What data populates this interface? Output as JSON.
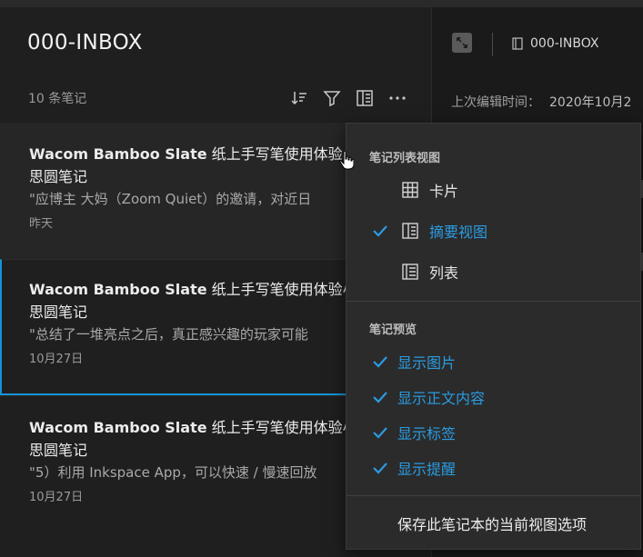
{
  "list": {
    "title": "000-INBOX",
    "count": "10 条笔记",
    "toolbar": [
      "sort-icon",
      "filter-icon",
      "view-options-icon",
      "more-icon"
    ]
  },
  "notes": [
    {
      "title_en": "Wacom Bamboo Slate",
      "title_cn": " 纸上手写笔使用体验小",
      "title_line2": "思圆笔记",
      "snippet": "\"应博主 大妈（Zoom Quiet）的邀请，对近日",
      "date": "昨天"
    },
    {
      "title_en": "Wacom Bamboo Slate",
      "title_cn": " 纸上手写笔使用体验小",
      "title_line2": "思圆笔记",
      "snippet": "\"总结了一堆亮点之后，真正感兴趣的玩家可能",
      "date": "10月27日"
    },
    {
      "title_en": "Wacom Bamboo Slate",
      "title_cn": " 纸上手写笔使用体验小",
      "title_line2": "思圆笔记",
      "snippet": "\"5）利用 Inkspace App，可以快速 / 慢速回放",
      "date": "10月27日"
    }
  ],
  "editor": {
    "notebook": "000-INBOX",
    "edit_label": "上次编辑时间：",
    "edit_value": "2020年10月2"
  },
  "menu": {
    "section_view": "笔记列表视图",
    "view_items": [
      {
        "label": "卡片",
        "icon": "card-grid-icon",
        "active": false
      },
      {
        "label": "摘要视图",
        "icon": "summary-view-icon",
        "active": true
      },
      {
        "label": "列表",
        "icon": "list-view-icon",
        "active": false
      }
    ],
    "section_preview": "笔记预览",
    "preview_items": [
      "显示图片",
      "显示正文内容",
      "显示标签",
      "显示提醒"
    ],
    "save_label": "保存此笔记本的当前视图选项"
  },
  "colors": {
    "accent": "#2b9be0",
    "selection_border": "#1593d6"
  }
}
